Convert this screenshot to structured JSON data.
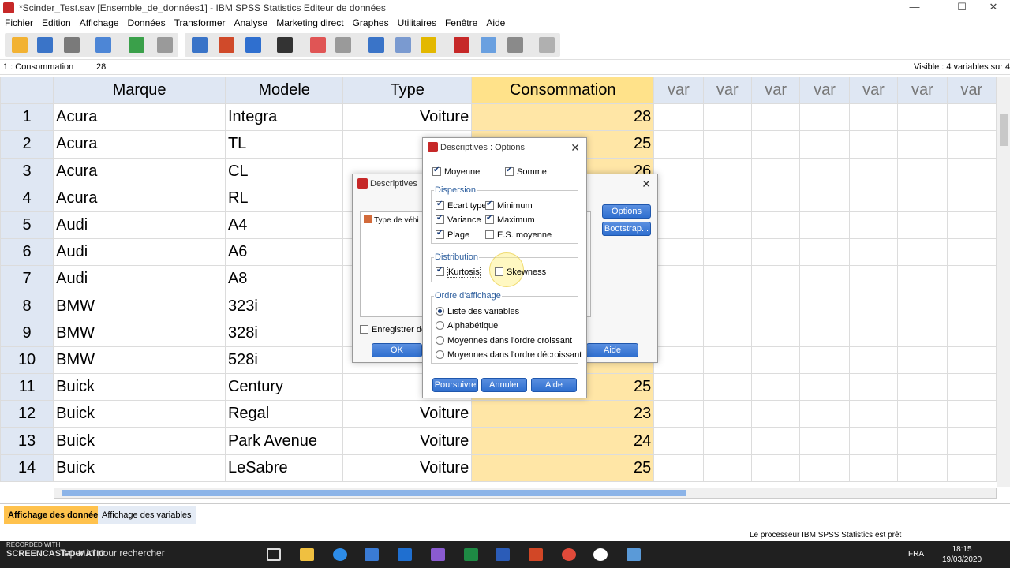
{
  "window": {
    "title": "*Scinder_Test.sav [Ensemble_de_données1] - IBM SPSS Statistics Editeur de données",
    "minimize": "—",
    "maximize": "☐",
    "close": "✕"
  },
  "menubar": [
    "Fichier",
    "Edition",
    "Affichage",
    "Données",
    "Transformer",
    "Analyse",
    "Marketing direct",
    "Graphes",
    "Utilitaires",
    "Fenêtre",
    "Aide"
  ],
  "cellbar": {
    "cell_ref": "1 : Consommation",
    "cell_value": "28",
    "visible": "Visible : 4 variables sur 4"
  },
  "grid": {
    "columns": [
      "Marque",
      "Modele",
      "Type",
      "Consommation",
      "var",
      "var",
      "var",
      "var",
      "var",
      "var",
      "var"
    ],
    "rows": [
      [
        "1",
        "Acura",
        "Integra",
        "Voiture",
        "28"
      ],
      [
        "2",
        "Acura",
        "TL",
        "",
        "25"
      ],
      [
        "3",
        "Acura",
        "CL",
        "",
        "26"
      ],
      [
        "4",
        "Acura",
        "RL",
        "",
        ""
      ],
      [
        "5",
        "Audi",
        "A4",
        "",
        ""
      ],
      [
        "6",
        "Audi",
        "A6",
        "",
        ""
      ],
      [
        "7",
        "Audi",
        "A8",
        "",
        ""
      ],
      [
        "8",
        "BMW",
        "323i",
        "",
        ""
      ],
      [
        "9",
        "BMW",
        "328i",
        "",
        ""
      ],
      [
        "10",
        "BMW",
        "528i",
        "",
        ""
      ],
      [
        "11",
        "Buick",
        "Century",
        "V",
        "25"
      ],
      [
        "12",
        "Buick",
        "Regal",
        "Voiture",
        "23"
      ],
      [
        "13",
        "Buick",
        "Park Avenue",
        "Voiture",
        "24"
      ],
      [
        "14",
        "Buick",
        "LeSabre",
        "Voiture",
        "25"
      ]
    ]
  },
  "view_tabs": {
    "data_view": "Affichage des données",
    "variable_view": "Affichage des variables"
  },
  "status": {
    "processor": "Le processeur IBM SPSS Statistics  est prêt"
  },
  "descriptives_dialog": {
    "title": "Descriptives",
    "variable_item": "Type de véhi",
    "options_button": "Options",
    "bootstrap_button": "Bootstrap...",
    "save_checkbox": "Enregistrer de",
    "ok_button": "OK",
    "help_button": "Aide"
  },
  "options_dialog": {
    "title": "Descriptives : Options",
    "mean": "Moyenne",
    "sum": "Somme",
    "dispersion_label": "Dispersion",
    "std_dev": "Ecart type",
    "minimum": "Minimum",
    "variance": "Variance",
    "maximum": "Maximum",
    "range": "Plage",
    "se_mean": "E.S. moyenne",
    "distribution_label": "Distribution",
    "kurtosis": "Kurtosis",
    "skewness": "Skewness",
    "display_order_label": "Ordre d'affichage",
    "order_variable_list": "Liste des variables",
    "order_alphabetic": "Alphabétique",
    "order_ascending": "Moyennes dans l'ordre croissant",
    "order_descending": "Moyennes dans l'ordre décroissant",
    "continue_button": "Poursuivre",
    "cancel_button": "Annuler",
    "help_button": "Aide"
  },
  "taskbar": {
    "watermark_line1": "RECORDED WITH",
    "watermark_line2": "SCREENCAST-O-MATIC",
    "search_placeholder": "Taper ici pour rechercher",
    "language": "FRA",
    "time": "18:15",
    "date": "19/03/2020"
  }
}
